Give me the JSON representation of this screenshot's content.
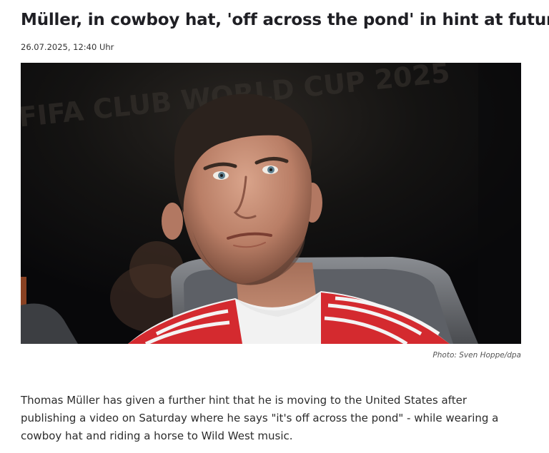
{
  "article": {
    "headline": "Müller, in cowboy hat, 'off across the pond' in hint at future",
    "dateline": "26.07.2025, 12:40 Uhr",
    "photo": {
      "background_text": "FIFA CLUB WORLD CUP 2025",
      "credit": "Photo: Sven Hoppe/dpa"
    },
    "body": "Thomas Müller has given a further hint that he is moving to the United States after publishing a video on Saturday where he says \"it's off across the pond\" - while wearing a cowboy hat and riding a horse to Wild West music."
  },
  "colors": {
    "headline": "#1f1f24",
    "jersey_red": "#d42a2f",
    "photo_background": "#0c0c0e"
  }
}
